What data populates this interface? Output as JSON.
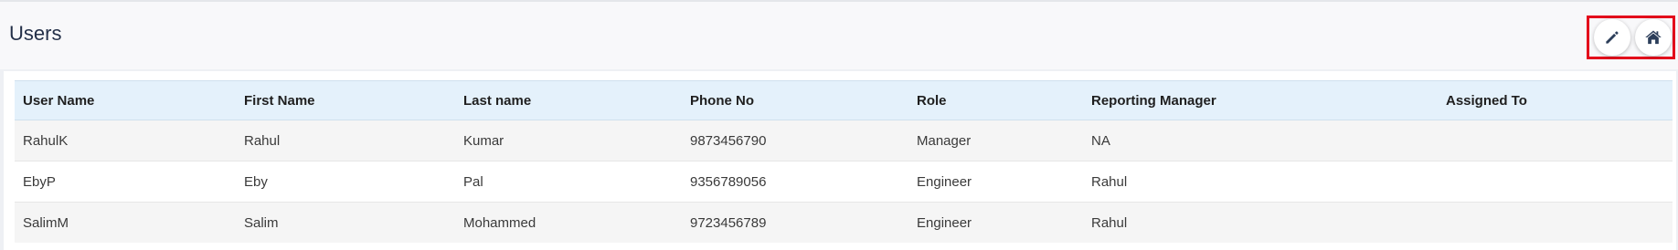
{
  "page": {
    "title": "Users"
  },
  "actions": {
    "edit_icon": "pencil-icon",
    "home_icon": "home-icon",
    "highlight_color": "#e3061b"
  },
  "table": {
    "headers": [
      "User Name",
      "First Name",
      "Last name",
      "Phone No",
      "Role",
      "Reporting Manager",
      "Assigned To"
    ],
    "rows": [
      [
        "RahulK",
        "Rahul",
        "Kumar",
        "9873456790",
        "Manager",
        "NA",
        ""
      ],
      [
        "EbyP",
        "Eby",
        "Pal",
        "9356789056",
        "Engineer",
        "Rahul",
        ""
      ],
      [
        "SalimM",
        "Salim",
        "Mohammed",
        "9723456789",
        "Engineer",
        "Rahul",
        ""
      ]
    ]
  },
  "colors": {
    "header_row_bg": "#e4f1fb",
    "title_color": "#243049",
    "icon_color": "#2c3e5a"
  }
}
